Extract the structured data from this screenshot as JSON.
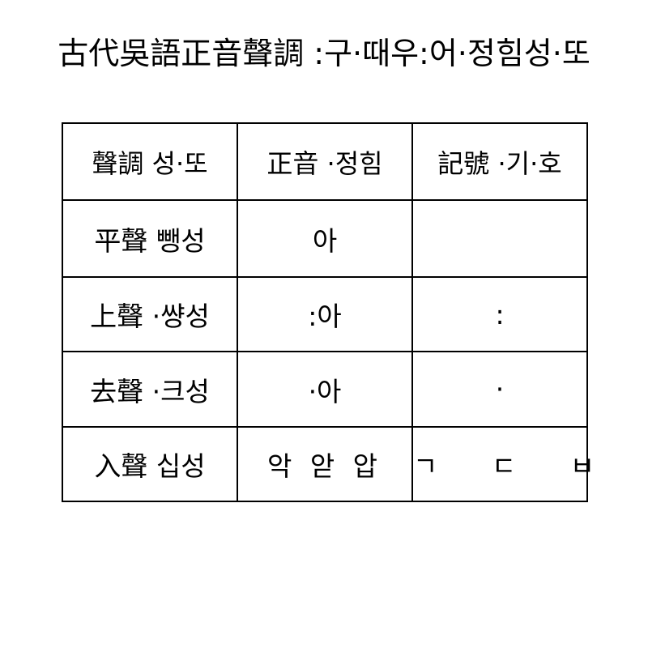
{
  "title": "古代吳語正音聲調 :구·때우:어·정힘성·또",
  "table": {
    "headers": [
      "聲調 성·또",
      "正音 ·정힘",
      "記號 ·기·호"
    ],
    "rows": [
      {
        "tone": "平聲 뺑성",
        "zhengyin": "아",
        "symbol": ""
      },
      {
        "tone": "上聲 ·썅성",
        "zhengyin": ":아",
        "symbol": ":"
      },
      {
        "tone": "去聲 ·크성",
        "zhengyin": "·아",
        "symbol": "·"
      },
      {
        "tone": "入聲 십성",
        "zhengyin": "악 앋 압",
        "symbol": "ㄱ ㄷ ㅂ"
      }
    ]
  }
}
